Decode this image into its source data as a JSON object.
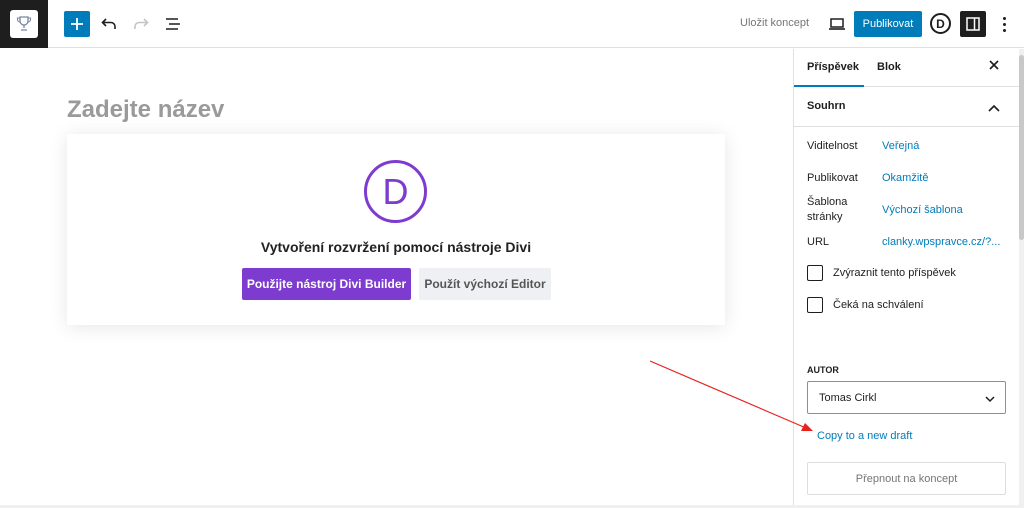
{
  "toolbar": {
    "save_draft": "Uložit koncept",
    "publish": "Publikovat",
    "divi_letter": "D"
  },
  "editor": {
    "title_placeholder": "Zadejte název",
    "divi_logo_letter": "D",
    "divi_heading": "Vytvoření rozvržení pomocí nástroje Divi",
    "divi_builder_button": "Použijte nástroj Divi Builder",
    "default_editor_button": "Použít výchozí Editor"
  },
  "sidebar": {
    "tabs": [
      {
        "label": "Příspěvek"
      },
      {
        "label": "Blok"
      }
    ],
    "summary_title": "Souhrn",
    "rows": [
      {
        "label": "Viditelnost",
        "value": "Veřejná"
      },
      {
        "label": "Publikovat",
        "value": "Okamžitě"
      },
      {
        "label": "Šablona stránky",
        "value": "Výchozí šablona"
      },
      {
        "label": "URL",
        "value": "clanky.wpspravce.cz/?..."
      }
    ],
    "checkboxes": [
      {
        "label": "Zvýraznit tento příspěvek"
      },
      {
        "label": "Čeká na schválení"
      }
    ],
    "author_label": "AUTOR",
    "author_value": "Tomas Cirkl",
    "copy_link": "Copy to a new draft",
    "switch_to_draft": "Přepnout na koncept"
  },
  "colors": {
    "accent": "#007cba",
    "divi_purple": "#7e3bd0",
    "annotation_arrow": "#e8231f"
  }
}
